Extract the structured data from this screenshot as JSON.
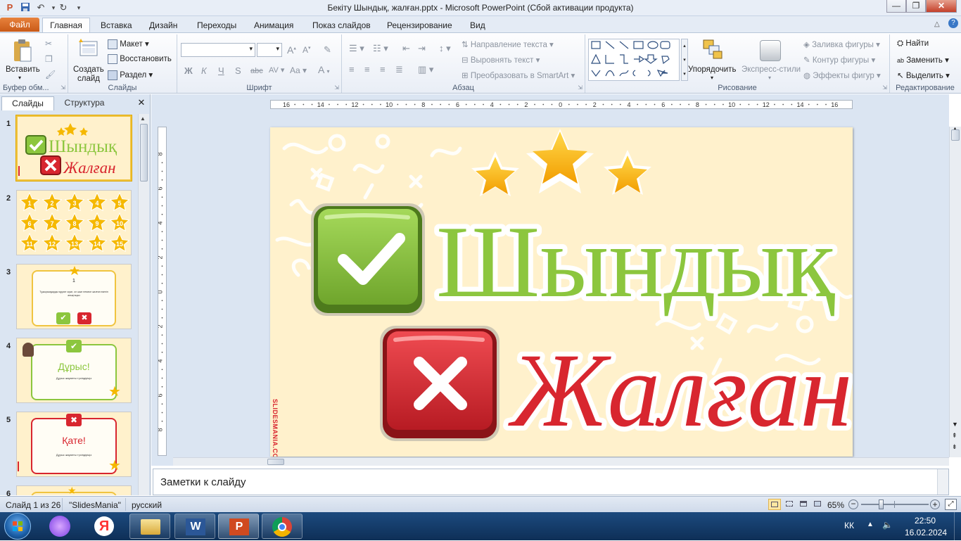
{
  "window": {
    "title": "Бекіту Шындық, жалған.pptx  -  Microsoft PowerPoint (Сбой активации продукта)",
    "minimize_icon": "minimize-icon",
    "maximize_icon": "restore-icon",
    "close_icon": "close-icon"
  },
  "ribbon_tabs": [
    "Файл",
    "Главная",
    "Вставка",
    "Дизайн",
    "Переходы",
    "Анимация",
    "Показ слайдов",
    "Рецензирование",
    "Вид"
  ],
  "ribbon": {
    "clipboard": {
      "label": "Буфер обм...",
      "paste": "Вставить"
    },
    "slides": {
      "label": "Слайды",
      "new_slide_1": "Создать",
      "new_slide_2": "слайд",
      "layout": "Макет",
      "reset": "Восстановить",
      "section": "Раздел"
    },
    "font": {
      "label": "Шрифт",
      "bold": "Ж",
      "italic": "К",
      "underline": "Ч",
      "shadow": "S",
      "strike": "abc",
      "spacing": "AV",
      "case": "Aa",
      "grow": "A",
      "shrink": "A",
      "color": "A"
    },
    "paragraph": {
      "label": "Абзац",
      "text_direction": "Направление текста",
      "align_text": "Выровнять текст",
      "smartart": "Преобразовать в SmartArt"
    },
    "drawing": {
      "label": "Рисование",
      "arrange": "Упорядочить",
      "quick_styles": "Экспресс-стили",
      "shape_fill": "Заливка фигуры",
      "shape_outline": "Контур фигуры",
      "shape_effects": "Эффекты фигур"
    },
    "editing": {
      "label": "Редактирование",
      "find": "Найти",
      "replace": "Заменить",
      "select": "Выделить"
    }
  },
  "panel": {
    "tab_slides": "Слайды",
    "tab_outline": "Структура",
    "close": "✕",
    "thumbnails": [
      {
        "num": "1",
        "top_text": "Шындық",
        "bottom_text": "Жалған"
      },
      {
        "num": "2",
        "stars": [
          "1",
          "2",
          "3",
          "4",
          "5",
          "6",
          "7",
          "8",
          "9",
          "10",
          "11",
          "12",
          "13",
          "14",
          "15"
        ]
      },
      {
        "num": "3",
        "q_num": "1",
        "q_text": "Тұжырымдарды мұқият оқып, ол шын немесе жалған екенін анықтаңыз"
      },
      {
        "num": "4",
        "heading": "Дұрыс!",
        "caption": "Дұрыс жауапты түсіндіріңіз"
      },
      {
        "num": "5",
        "heading": "Қате!",
        "caption": "Дұрыс жауапты түсіндіріңіз"
      },
      {
        "num": "6"
      }
    ]
  },
  "ruler": {
    "h_labels": [
      "16",
      "14",
      "12",
      "10",
      "8",
      "6",
      "4",
      "2",
      "0",
      "2",
      "4",
      "6",
      "8",
      "10",
      "12",
      "14",
      "16"
    ],
    "v_labels": [
      "8",
      "6",
      "4",
      "2",
      "0",
      "2",
      "4",
      "6",
      "8"
    ]
  },
  "slide": {
    "word_true": "Шындық",
    "word_false": "Жалған",
    "watermark": "SLIDESMANIA.COM",
    "true_icon": "checkmark-icon",
    "false_icon": "cross-icon",
    "star_icon": "star-icon"
  },
  "notes": {
    "placeholder": "Заметки к слайду"
  },
  "status": {
    "slide_info": "Слайд 1 из 26",
    "theme": "\"SlidesMania\"",
    "language": "русский",
    "zoom": "65%",
    "zoom_fraction": 0.65
  },
  "taskbar": {
    "apps": [
      "start-orb-icon",
      "alice-icon",
      "yandex-icon",
      "explorer-icon",
      "word-icon",
      "powerpoint-icon",
      "chrome-icon"
    ],
    "lang": "КК",
    "time": "22:50",
    "date": "16.02.2024"
  },
  "colors": {
    "slide_bg": "#fff1cc",
    "true_green": "#8cc63e",
    "false_red": "#d8262f",
    "star_gold": "#f5b800",
    "file_tab": "#d7661f"
  }
}
